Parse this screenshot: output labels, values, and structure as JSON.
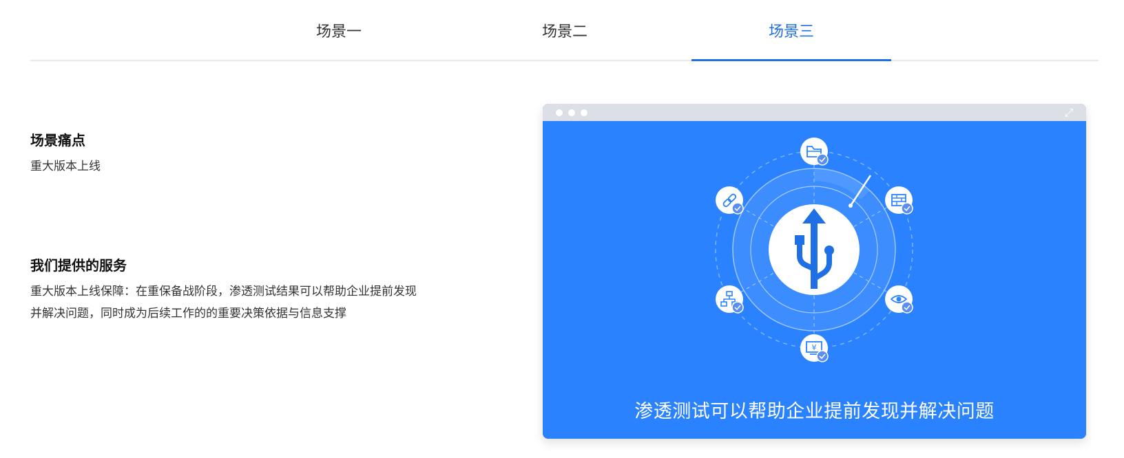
{
  "tabs": [
    {
      "label": "场景一",
      "active": false
    },
    {
      "label": "场景二",
      "active": false
    },
    {
      "label": "场景三",
      "active": true
    }
  ],
  "pain_point": {
    "title": "场景痛点",
    "text": "重大版本上线"
  },
  "service": {
    "title": "我们提供的服务",
    "text_line1": "重大版本上线保障：在重保备战阶段，渗透测试结果可以帮助企业提前发现",
    "text_line2": "并解决问题，同时成为后续工作的的重要决策依据与信息支撑"
  },
  "illustration": {
    "caption": "渗透测试可以帮助企业提前发现并解决问题",
    "center_icon": "usb-upload-icon",
    "orbit_icons": [
      "folder-icon",
      "firewall-icon",
      "eye-icon",
      "yen-monitor-icon",
      "network-tree-icon",
      "link-icon"
    ]
  },
  "colors": {
    "accent": "#1f6fe5",
    "panel_bg": "#2a82fe",
    "bar_bg": "#dcdfe6"
  }
}
